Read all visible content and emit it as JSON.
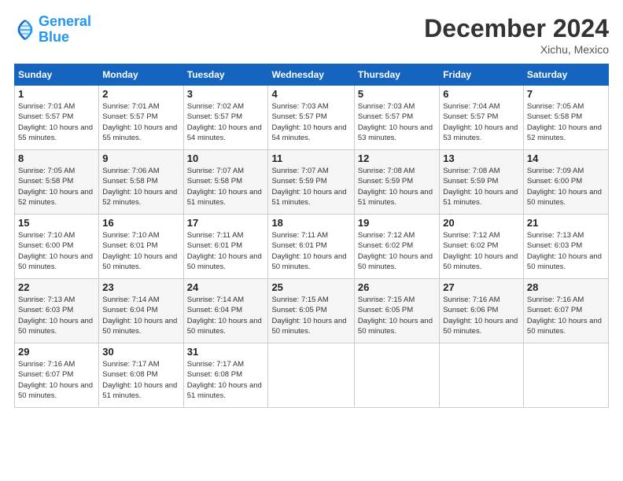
{
  "logo": {
    "line1": "General",
    "line2": "Blue"
  },
  "title": "December 2024",
  "location": "Xichu, Mexico",
  "weekdays": [
    "Sunday",
    "Monday",
    "Tuesday",
    "Wednesday",
    "Thursday",
    "Friday",
    "Saturday"
  ],
  "weeks": [
    [
      {
        "day": "1",
        "sunrise": "7:01 AM",
        "sunset": "5:57 PM",
        "daylight": "10 hours and 55 minutes."
      },
      {
        "day": "2",
        "sunrise": "7:01 AM",
        "sunset": "5:57 PM",
        "daylight": "10 hours and 55 minutes."
      },
      {
        "day": "3",
        "sunrise": "7:02 AM",
        "sunset": "5:57 PM",
        "daylight": "10 hours and 54 minutes."
      },
      {
        "day": "4",
        "sunrise": "7:03 AM",
        "sunset": "5:57 PM",
        "daylight": "10 hours and 54 minutes."
      },
      {
        "day": "5",
        "sunrise": "7:03 AM",
        "sunset": "5:57 PM",
        "daylight": "10 hours and 53 minutes."
      },
      {
        "day": "6",
        "sunrise": "7:04 AM",
        "sunset": "5:57 PM",
        "daylight": "10 hours and 53 minutes."
      },
      {
        "day": "7",
        "sunrise": "7:05 AM",
        "sunset": "5:58 PM",
        "daylight": "10 hours and 52 minutes."
      }
    ],
    [
      {
        "day": "8",
        "sunrise": "7:05 AM",
        "sunset": "5:58 PM",
        "daylight": "10 hours and 52 minutes."
      },
      {
        "day": "9",
        "sunrise": "7:06 AM",
        "sunset": "5:58 PM",
        "daylight": "10 hours and 52 minutes."
      },
      {
        "day": "10",
        "sunrise": "7:07 AM",
        "sunset": "5:58 PM",
        "daylight": "10 hours and 51 minutes."
      },
      {
        "day": "11",
        "sunrise": "7:07 AM",
        "sunset": "5:59 PM",
        "daylight": "10 hours and 51 minutes."
      },
      {
        "day": "12",
        "sunrise": "7:08 AM",
        "sunset": "5:59 PM",
        "daylight": "10 hours and 51 minutes."
      },
      {
        "day": "13",
        "sunrise": "7:08 AM",
        "sunset": "5:59 PM",
        "daylight": "10 hours and 51 minutes."
      },
      {
        "day": "14",
        "sunrise": "7:09 AM",
        "sunset": "6:00 PM",
        "daylight": "10 hours and 50 minutes."
      }
    ],
    [
      {
        "day": "15",
        "sunrise": "7:10 AM",
        "sunset": "6:00 PM",
        "daylight": "10 hours and 50 minutes."
      },
      {
        "day": "16",
        "sunrise": "7:10 AM",
        "sunset": "6:01 PM",
        "daylight": "10 hours and 50 minutes."
      },
      {
        "day": "17",
        "sunrise": "7:11 AM",
        "sunset": "6:01 PM",
        "daylight": "10 hours and 50 minutes."
      },
      {
        "day": "18",
        "sunrise": "7:11 AM",
        "sunset": "6:01 PM",
        "daylight": "10 hours and 50 minutes."
      },
      {
        "day": "19",
        "sunrise": "7:12 AM",
        "sunset": "6:02 PM",
        "daylight": "10 hours and 50 minutes."
      },
      {
        "day": "20",
        "sunrise": "7:12 AM",
        "sunset": "6:02 PM",
        "daylight": "10 hours and 50 minutes."
      },
      {
        "day": "21",
        "sunrise": "7:13 AM",
        "sunset": "6:03 PM",
        "daylight": "10 hours and 50 minutes."
      }
    ],
    [
      {
        "day": "22",
        "sunrise": "7:13 AM",
        "sunset": "6:03 PM",
        "daylight": "10 hours and 50 minutes."
      },
      {
        "day": "23",
        "sunrise": "7:14 AM",
        "sunset": "6:04 PM",
        "daylight": "10 hours and 50 minutes."
      },
      {
        "day": "24",
        "sunrise": "7:14 AM",
        "sunset": "6:04 PM",
        "daylight": "10 hours and 50 minutes."
      },
      {
        "day": "25",
        "sunrise": "7:15 AM",
        "sunset": "6:05 PM",
        "daylight": "10 hours and 50 minutes."
      },
      {
        "day": "26",
        "sunrise": "7:15 AM",
        "sunset": "6:05 PM",
        "daylight": "10 hours and 50 minutes."
      },
      {
        "day": "27",
        "sunrise": "7:16 AM",
        "sunset": "6:06 PM",
        "daylight": "10 hours and 50 minutes."
      },
      {
        "day": "28",
        "sunrise": "7:16 AM",
        "sunset": "6:07 PM",
        "daylight": "10 hours and 50 minutes."
      }
    ],
    [
      {
        "day": "29",
        "sunrise": "7:16 AM",
        "sunset": "6:07 PM",
        "daylight": "10 hours and 50 minutes."
      },
      {
        "day": "30",
        "sunrise": "7:17 AM",
        "sunset": "6:08 PM",
        "daylight": "10 hours and 51 minutes."
      },
      {
        "day": "31",
        "sunrise": "7:17 AM",
        "sunset": "6:08 PM",
        "daylight": "10 hours and 51 minutes."
      },
      null,
      null,
      null,
      null
    ]
  ]
}
